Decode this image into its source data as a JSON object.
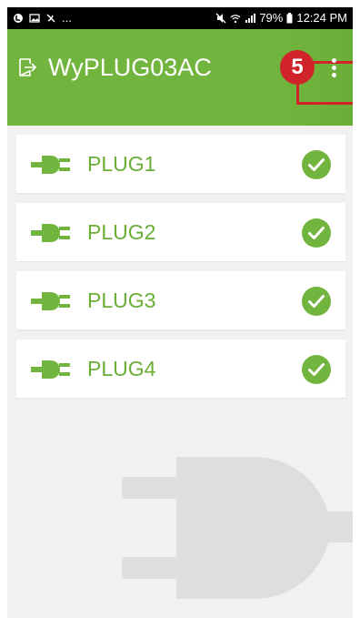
{
  "status_bar": {
    "left_text": "...",
    "battery_text": "79%",
    "time": "12:24 PM",
    "icons": [
      "app-notification-icon",
      "image-icon",
      "muted-call-icon",
      "mute-icon",
      "wifi-icon",
      "signal-icon",
      "battery-icon"
    ]
  },
  "app_bar": {
    "title": "WyPLUG03AC",
    "exit_icon": "exit-icon",
    "menu_icon": "more-vertical-icon",
    "accent_color": "#72b53e"
  },
  "annotation": {
    "step_number": "5",
    "color": "#d0232a"
  },
  "plugs": [
    {
      "label": "PLUG1",
      "status": "connected",
      "icon": "plug-icon",
      "status_icon": "check-circle-icon"
    },
    {
      "label": "PLUG2",
      "status": "connected",
      "icon": "plug-icon",
      "status_icon": "check-circle-icon"
    },
    {
      "label": "PLUG3",
      "status": "connected",
      "icon": "plug-icon",
      "status_icon": "check-circle-icon"
    },
    {
      "label": "PLUG4",
      "status": "connected",
      "icon": "plug-icon",
      "status_icon": "check-circle-icon"
    }
  ],
  "background_decoration": "plug-watermark"
}
